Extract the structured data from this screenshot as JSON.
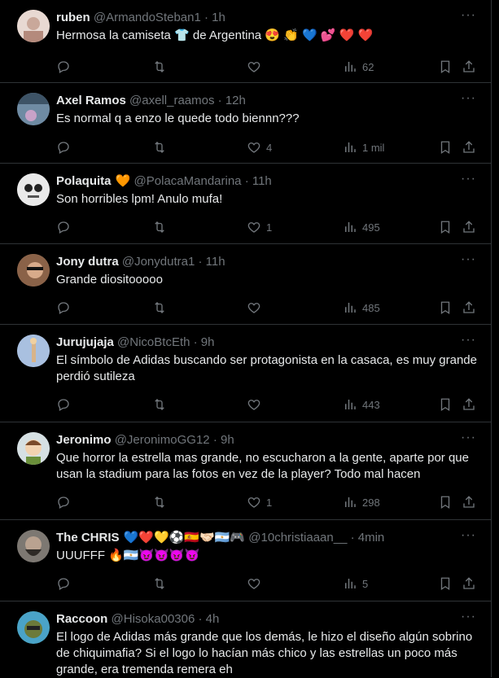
{
  "tweets": [
    {
      "name": "ruben",
      "name_emoji": "",
      "handle": "@ArmandoSteban1",
      "time": "1h",
      "text": "Hermosa la camiseta 👕 de Argentina 😍 👏 💙 💕 ❤️ ❤️",
      "likes": "",
      "views": "62",
      "avatar_color": "#d9c1b8"
    },
    {
      "name": "Axel Ramos",
      "name_emoji": "",
      "handle": "@axell_raamos",
      "time": "12h",
      "text": "Es normal q a enzo le quede todo biennn???",
      "likes": "4",
      "views": "1 mil",
      "avatar_color": "#5f7a8f"
    },
    {
      "name": "Polaquita",
      "name_emoji": "🧡",
      "handle": "@PolacaMandarina",
      "time": "11h",
      "text": "Son horribles lpm! Anulo mufa!",
      "likes": "1",
      "views": "495",
      "avatar_color": "#e9e9e9"
    },
    {
      "name": "Jony dutra",
      "name_emoji": "",
      "handle": "@Jonydutra1",
      "time": "11h",
      "text": "Grande diositooooo",
      "likes": "",
      "views": "485",
      "avatar_color": "#a57a5d"
    },
    {
      "name": "Jurujujaja",
      "name_emoji": "",
      "handle": "@NicoBtcEth",
      "time": "9h",
      "text": "El símbolo de Adidas buscando ser protagonista en la casaca, es muy grande perdió sutileza",
      "likes": "",
      "views": "443",
      "avatar_color": "#9fb7d9"
    },
    {
      "name": "Jeronimo",
      "name_emoji": "",
      "handle": "@JeronimoGG12",
      "time": "9h",
      "text": "Que horror la estrella mas grande, no escucharon a la gente, aparte por que usan la stadium para las fotos en vez de la player? Todo mal hacen",
      "likes": "1",
      "views": "298",
      "avatar_color": "#c9d3d6"
    },
    {
      "name": "The CHRIS",
      "name_emoji": "💙❤️💛⚽🇪🇸🤝🏻🇦🇷🎮",
      "handle": "@10christiaaan__",
      "time": "4min",
      "text": "UUUFFF 🔥🇦🇷😈😈😈😈",
      "likes": "",
      "views": "5",
      "avatar_color": "#6d6a66"
    },
    {
      "name": "Raccoon",
      "name_emoji": "",
      "handle": "@Hisoka00306",
      "time": "4h",
      "text": "El logo de Adidas más grande que los demás, le hizo el diseño algún sobrino de chiquimafia? Si el logo lo hacían más chico y las estrellas un poco más grande, era tremenda remera eh",
      "likes": "",
      "views": "",
      "avatar_color": "#3a8a7a"
    }
  ],
  "icons": {
    "reply": "reply-icon",
    "retweet": "retweet-icon",
    "like": "heart-icon",
    "views": "views-chart-icon",
    "bookmark": "bookmark-icon",
    "share": "share-icon",
    "more": "more-dots-icon"
  },
  "more_label": "···",
  "separator": "·"
}
